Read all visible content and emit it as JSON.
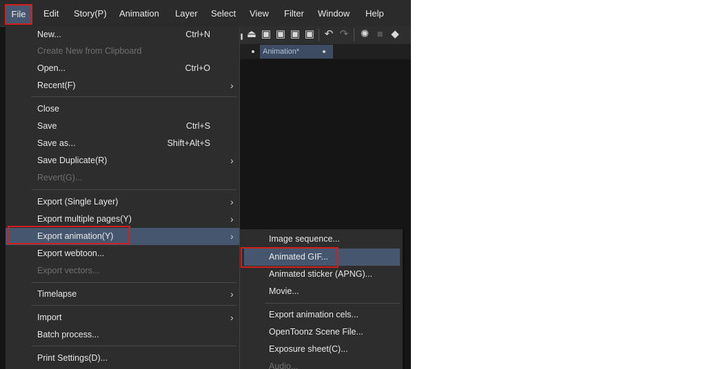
{
  "menubar": {
    "items": [
      "File",
      "Edit",
      "Story(P)",
      "Animation",
      "Layer",
      "Select",
      "View",
      "Filter",
      "Window",
      "Help"
    ]
  },
  "tab": {
    "label": "Animation*"
  },
  "file_menu": {
    "new": {
      "label": "New...",
      "shortcut": "Ctrl+N"
    },
    "create_from_clipboard": {
      "label": "Create New from Clipboard"
    },
    "open": {
      "label": "Open...",
      "shortcut": "Ctrl+O"
    },
    "recent": {
      "label": "Recent(F)"
    },
    "close": {
      "label": "Close"
    },
    "save": {
      "label": "Save",
      "shortcut": "Ctrl+S"
    },
    "save_as": {
      "label": "Save as...",
      "shortcut": "Shift+Alt+S"
    },
    "save_duplicate": {
      "label": "Save Duplicate(R)"
    },
    "revert": {
      "label": "Revert(G)..."
    },
    "export_single": {
      "label": "Export (Single Layer)"
    },
    "export_multiple": {
      "label": "Export multiple pages(Y)"
    },
    "export_animation": {
      "label": "Export animation(Y)"
    },
    "export_webtoon": {
      "label": "Export webtoon..."
    },
    "export_vectors": {
      "label": "Export vectors..."
    },
    "timelapse": {
      "label": "Timelapse"
    },
    "import": {
      "label": "Import"
    },
    "batch": {
      "label": "Batch process..."
    },
    "print_settings": {
      "label": "Print Settings(D)..."
    }
  },
  "export_animation_submenu": {
    "image_sequence": "Image sequence...",
    "animated_gif": "Animated GIF...",
    "animated_sticker": "Animated sticker (APNG)...",
    "movie": "Movie...",
    "export_cels": "Export animation cels...",
    "opentoonz": "OpenToonz Scene File...",
    "exposure_sheet": "Exposure sheet(C)...",
    "audio": "Audio..."
  },
  "colors": {
    "highlight": "#46566f",
    "callout_box": "#d51f1f",
    "menu_bg": "#2d2d2d"
  }
}
